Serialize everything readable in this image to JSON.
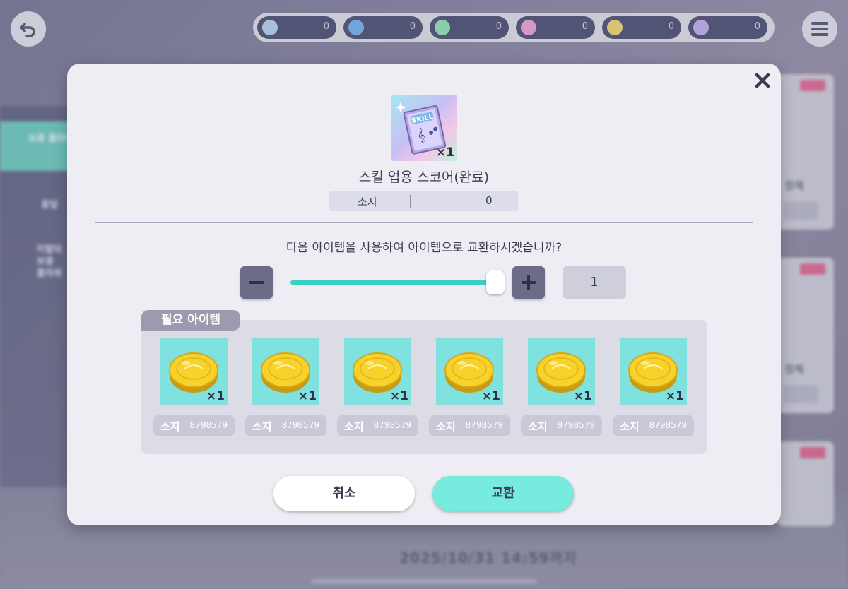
{
  "background": {
    "left_tabs": [
      "보충\n플라워",
      "꽃잎",
      "미발되\n보충\n플라워"
    ],
    "right_labels": [
      "정체",
      "정체"
    ],
    "date_text": "2025/10/31 14:59까지"
  },
  "hud": {
    "back_icon": "back-arrow-icon",
    "menu_icon": "hamburger-menu-icon",
    "stones": [
      {
        "color": "#b8d6f0",
        "value": "0"
      },
      {
        "color": "#7ab7f0",
        "value": "0"
      },
      {
        "color": "#9be7b8",
        "value": "0"
      },
      {
        "color": "#f0a6d6",
        "value": "0"
      },
      {
        "color": "#f2da7a",
        "value": "0"
      },
      {
        "color": "#c3b3f0",
        "value": "0"
      }
    ]
  },
  "dialog": {
    "close_icon": "close-icon",
    "item": {
      "name": "스킬 업용 스코어(완료)",
      "quantity": "×1",
      "icon": "skill-score-icon"
    },
    "owned": {
      "label": "소지",
      "value": "0"
    },
    "question": "다음 아이템을 사용하여 아이템으로 교환하시겠습니까?",
    "stepper": {
      "minus_icon": "minus-icon",
      "plus_icon": "plus-icon",
      "count": "1",
      "slider_fraction": 1.0
    },
    "required": {
      "title": "필요 아이템",
      "items": [
        {
          "quantity": "×1",
          "owned_label": "소지",
          "owned_value": "8798579"
        },
        {
          "quantity": "×1",
          "owned_label": "소지",
          "owned_value": "8798579"
        },
        {
          "quantity": "×1",
          "owned_label": "소지",
          "owned_value": "8798579"
        },
        {
          "quantity": "×1",
          "owned_label": "소지",
          "owned_value": "8798579"
        },
        {
          "quantity": "×1",
          "owned_label": "소지",
          "owned_value": "8798579"
        },
        {
          "quantity": "×1",
          "owned_label": "소지",
          "owned_value": "8798579"
        }
      ]
    },
    "buttons": {
      "cancel": "취소",
      "exchange": "교환"
    },
    "colors": {
      "accent": "#76ebde",
      "slider": "#3cd0c5",
      "coin_bg": "#7fe2df"
    }
  }
}
